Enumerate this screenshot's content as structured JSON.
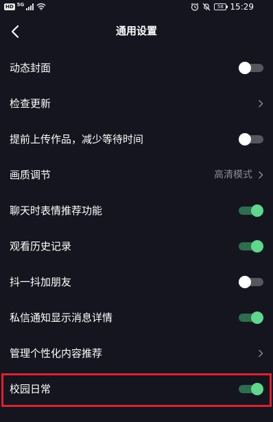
{
  "status_bar": {
    "hd": "HD",
    "network": "5G",
    "battery": "58",
    "time": "15:29"
  },
  "header": {
    "title": "通用设置",
    "back_icon": "chevron-left-icon"
  },
  "settings": [
    {
      "label": "动态封面",
      "control": "toggle",
      "on": false
    },
    {
      "label": "检查更新",
      "control": "chevron",
      "value": ""
    },
    {
      "label": "提前上传作品，减少等待时间",
      "control": "toggle",
      "on": false
    },
    {
      "label": "画质调节",
      "control": "chevron",
      "value": "高清模式"
    },
    {
      "label": "聊天时表情推荐功能",
      "control": "toggle",
      "on": true
    },
    {
      "label": "观看历史记录",
      "control": "toggle",
      "on": true
    },
    {
      "label": "抖一抖加朋友",
      "control": "toggle",
      "on": false
    },
    {
      "label": "私信通知显示消息详情",
      "control": "toggle",
      "on": true
    },
    {
      "label": "管理个性化内容推荐",
      "control": "chevron",
      "value": ""
    },
    {
      "label": "校园日常",
      "control": "toggle",
      "on": true,
      "highlighted": true
    }
  ],
  "colors": {
    "background": "#15151f",
    "toggle_on": "#5fd88e",
    "toggle_off_track": "#56565e",
    "highlight": "#e0202a",
    "secondary_text": "#8a8a93"
  }
}
